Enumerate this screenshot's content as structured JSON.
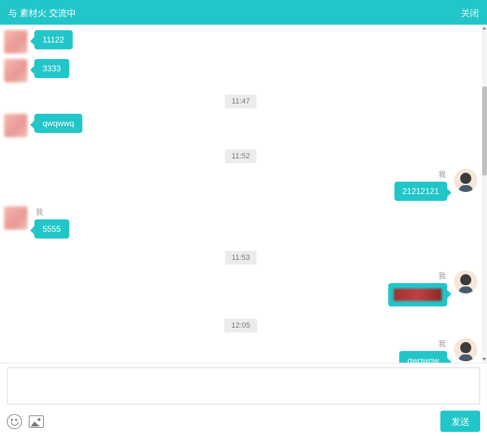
{
  "header": {
    "title": "与 素材火 交流中",
    "close": "关闭"
  },
  "me_label": "我",
  "timeline": [
    {
      "type": "msg",
      "side": "left",
      "avatar": "other",
      "name": "",
      "text": "11122"
    },
    {
      "type": "msg",
      "side": "left",
      "avatar": "other",
      "name": "",
      "text": "3333"
    },
    {
      "type": "time",
      "text": "11:47"
    },
    {
      "type": "msg",
      "side": "left",
      "avatar": "other",
      "name": "",
      "text": "qwqwwq"
    },
    {
      "type": "time",
      "text": "11:52"
    },
    {
      "type": "msg",
      "side": "right",
      "avatar": "me",
      "name": "我",
      "text": "21212121"
    },
    {
      "type": "msg",
      "side": "left",
      "avatar": "other",
      "name": "我",
      "text": "5555"
    },
    {
      "type": "time",
      "text": "11:53"
    },
    {
      "type": "img",
      "side": "right",
      "avatar": "me",
      "name": "我"
    },
    {
      "type": "time",
      "text": "12:05"
    },
    {
      "type": "msg",
      "side": "right",
      "avatar": "me",
      "name": "我",
      "text": "qwqwqw"
    }
  ],
  "input": {
    "placeholder": "",
    "value": ""
  },
  "toolbar": {
    "send_label": "发送"
  }
}
